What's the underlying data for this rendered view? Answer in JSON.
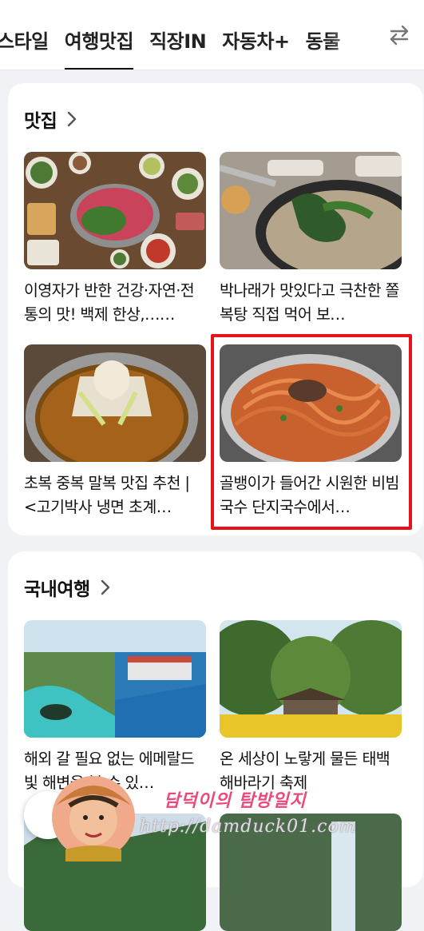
{
  "tabs": [
    "스타일",
    "여행맛집",
    "직장IN",
    "자동차+",
    "동물"
  ],
  "active_tab": "여행맛집",
  "tab_swap_icon": "swap-arrows-icon",
  "sections": [
    {
      "title": "맛집",
      "items": [
        {
          "title": "이영자가 반한 건강·자연·전통의 맛! 백제 한상,……"
        },
        {
          "title": "박나래가 맛있다고 극찬한 쫄복탕 직접 먹어 보…"
        },
        {
          "title": "초복 중복 말복 맛집 추천 | <고기박사 냉면 초계…"
        },
        {
          "title": "골뱅이가 들어간 시원한 비빔국수 단지국수에서…"
        }
      ]
    },
    {
      "title": "국내여행",
      "items": [
        {
          "title": "해외 갈 필요 없는 에메랄드 빛 해변을 볼 수 있…"
        },
        {
          "title": "온 세상이 노랗게 물든 태백 해바라기 축제"
        }
      ]
    }
  ],
  "watermark": {
    "name": "담덕이의 탐방일지",
    "url": "http://damduck01.com"
  },
  "colors": {
    "highlight": "#e8101a",
    "background": "#f1f2f5",
    "active_tab_underline": "#111111"
  }
}
